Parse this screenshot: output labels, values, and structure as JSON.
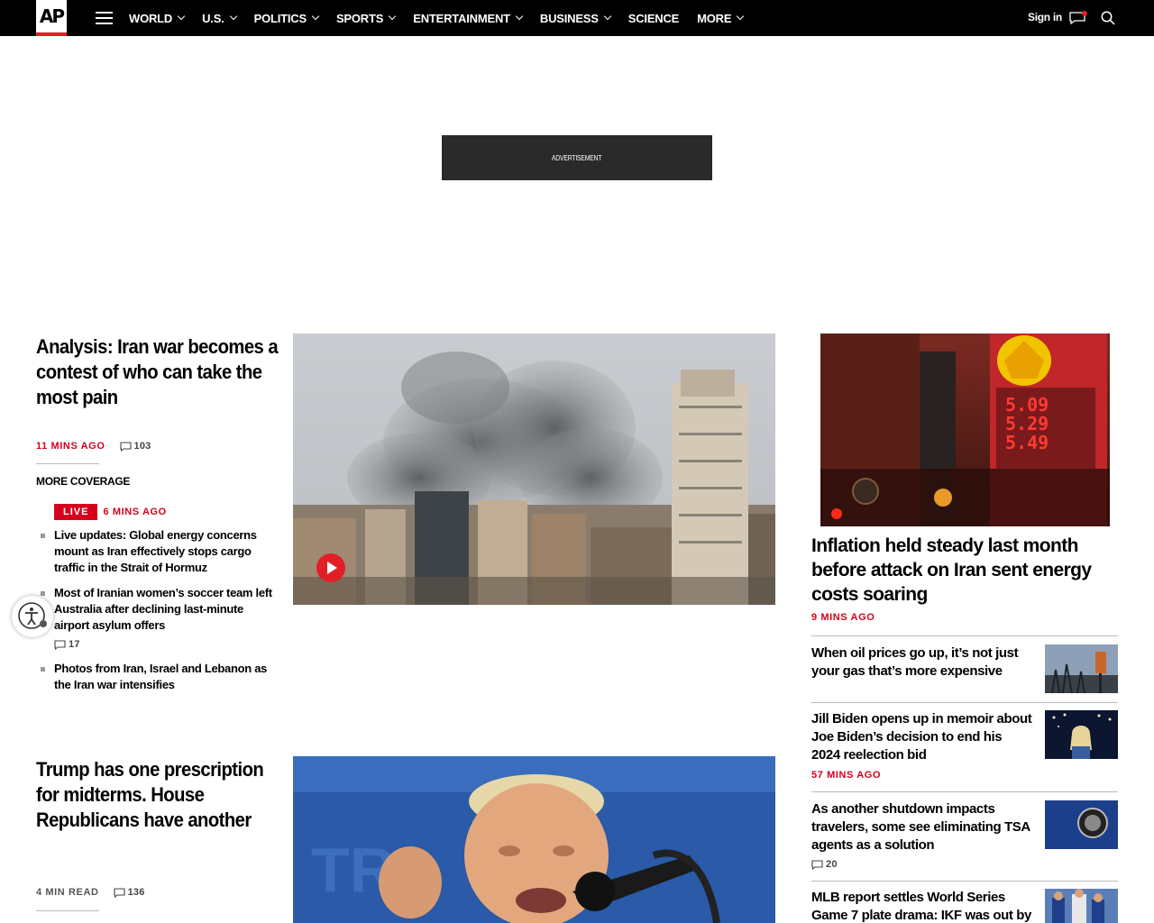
{
  "brand": {
    "logo_text": "AP",
    "accent": "#e21f26"
  },
  "nav": {
    "items": [
      {
        "label": "WORLD",
        "dropdown": true
      },
      {
        "label": "U.S.",
        "dropdown": true
      },
      {
        "label": "POLITICS",
        "dropdown": true
      },
      {
        "label": "SPORTS",
        "dropdown": true
      },
      {
        "label": "ENTERTAINMENT",
        "dropdown": true
      },
      {
        "label": "BUSINESS",
        "dropdown": true
      },
      {
        "label": "SCIENCE",
        "dropdown": false
      },
      {
        "label": "MORE",
        "dropdown": true
      }
    ],
    "signin": "Sign in",
    "icons": [
      "menu-icon",
      "chat-icon",
      "search-icon"
    ]
  },
  "ad": {
    "label": "ADVERTISEMENT"
  },
  "lead": {
    "headline": "Analysis: Iran war becomes a contest of who can take the most pain",
    "time": "11 MINS AGO",
    "comments": "103",
    "more_coverage": "MORE COVERAGE",
    "live_badge": "LIVE",
    "live_time": "6 MINS AGO",
    "items": [
      {
        "text": "Live updates: Global energy concerns mount as Iran effectively stops cargo traffic in the Strait of Hormuz"
      },
      {
        "text": "Most of Iranian women’s soccer team left Australia after declining last-minute airport asylum offers",
        "comments": "17"
      },
      {
        "text": "Photos from Iran, Israel and Lebanon as the Iran war intensifies"
      }
    ]
  },
  "second": {
    "headline": "Trump has one prescription for midterms. House Republicans have another",
    "read_time": "4 MIN READ",
    "comments": "136"
  },
  "side": {
    "headline": "Inflation held steady last month before attack on Iran sent energy costs soaring",
    "time": "9 MINS AGO",
    "items": [
      {
        "text": "When oil prices go up, it’s not just your gas that’s more expensive"
      },
      {
        "text": "Jill Biden opens up in memoir about Joe Biden’s decision to end his 2024 reelection bid",
        "time": "57 MINS AGO"
      },
      {
        "text": "As another shutdown impacts travelers, some see eliminating TSA agents as a solution",
        "comments": "20"
      },
      {
        "text": "MLB report settles World Series Game 7 plate drama: IKF was out by"
      }
    ],
    "gas_prices": [
      "5.09",
      "5.29",
      "5.49"
    ]
  }
}
